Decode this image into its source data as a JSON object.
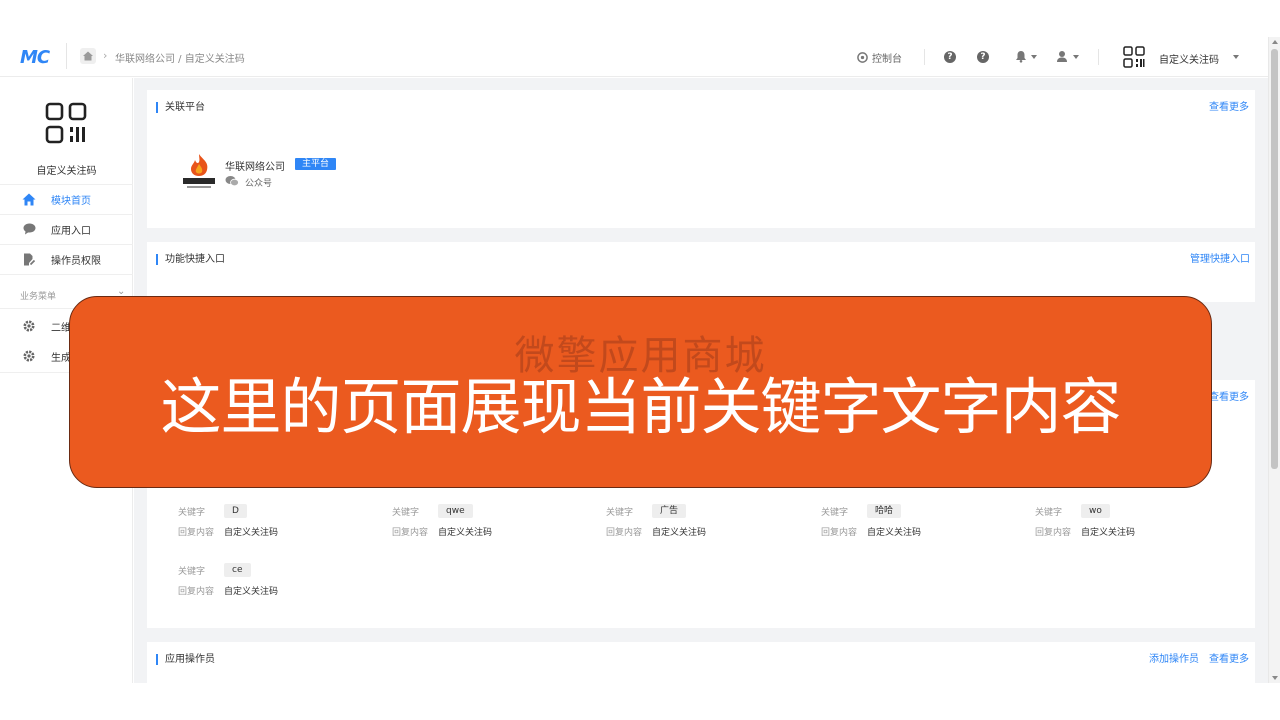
{
  "header": {
    "logo": "MC",
    "breadcrumb": "华联网络公司 / 自定义关注码",
    "console_label": "控制台",
    "app_name": "自定义关注码"
  },
  "sidebar": {
    "app_name": "自定义关注码",
    "items": [
      {
        "label": "模块首页",
        "icon": "home-icon",
        "active": true
      },
      {
        "label": "应用入口",
        "icon": "chat-icon",
        "active": false
      },
      {
        "label": "操作员权限",
        "icon": "edit-doc-icon",
        "active": false
      }
    ],
    "group_label": "业务菜单",
    "group_items": [
      {
        "label": "二维",
        "icon": "gear-icon"
      },
      {
        "label": "生成",
        "icon": "gear-icon"
      }
    ]
  },
  "cards": {
    "platform": {
      "title": "关联平台",
      "more": "查看更多",
      "name": "华联网络公司",
      "badge": "主平台",
      "type": "公众号"
    },
    "shortcuts": {
      "title": "功能快捷入口",
      "manage": "管理快捷入口"
    },
    "keywords": {
      "more": "查看更多",
      "keyword_label": "关键字",
      "reply_label": "回复内容",
      "items": [
        {
          "keyword": "D",
          "reply": "自定义关注码"
        },
        {
          "keyword": "qwe",
          "reply": "自定义关注码"
        },
        {
          "keyword": "广告",
          "reply": "自定义关注码"
        },
        {
          "keyword": "哈哈",
          "reply": "自定义关注码"
        },
        {
          "keyword": "wo",
          "reply": "自定义关注码"
        },
        {
          "keyword": "ce",
          "reply": "自定义关注码"
        }
      ]
    },
    "operators": {
      "title": "应用操作员",
      "add": "添加操作员",
      "more": "查看更多"
    }
  },
  "overlay": {
    "watermark": "微擎应用商城",
    "text": "这里的页面展现当前关键字文字内容"
  },
  "colors": {
    "accent": "#2f86f6",
    "overlay": "#eb5a1f"
  }
}
